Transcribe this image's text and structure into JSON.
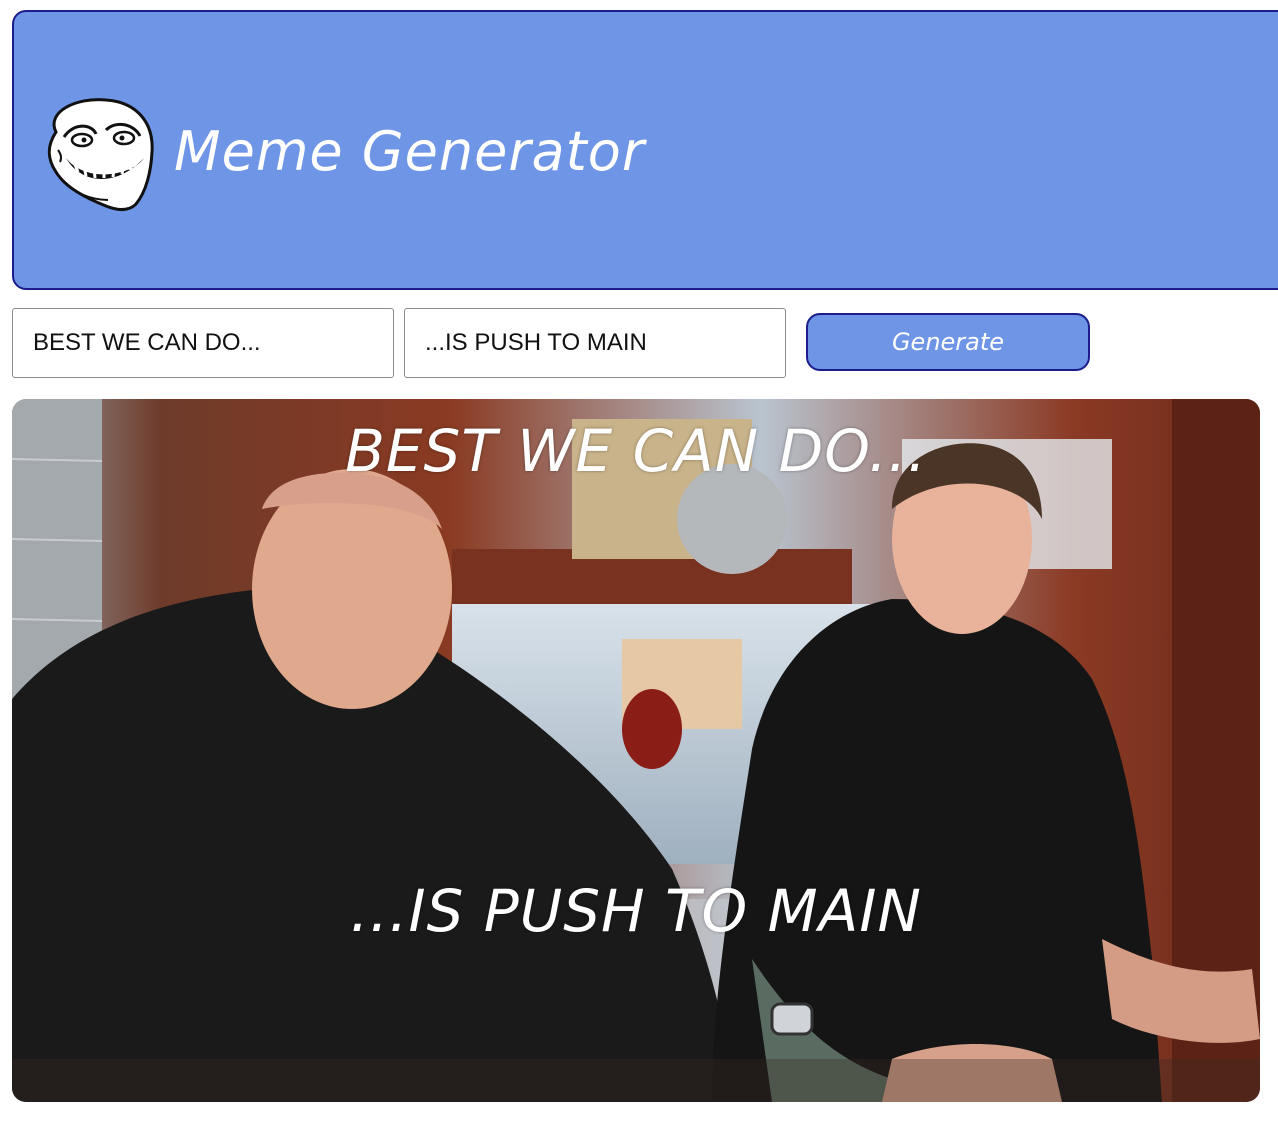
{
  "app": {
    "title": "Meme Generator",
    "logo_icon": "trollface-icon"
  },
  "form": {
    "top_text_value": "BEST WE CAN DO...",
    "bottom_text_value": "...IS PUSH TO MAIN",
    "generate_label": "Generate"
  },
  "meme": {
    "top_text": "BEST WE CAN DO...",
    "bottom_text": "...IS PUSH TO MAIN"
  },
  "colors": {
    "accent": "#6f95e6",
    "border": "#1c1d8a",
    "text_on_accent": "#ffffff"
  }
}
